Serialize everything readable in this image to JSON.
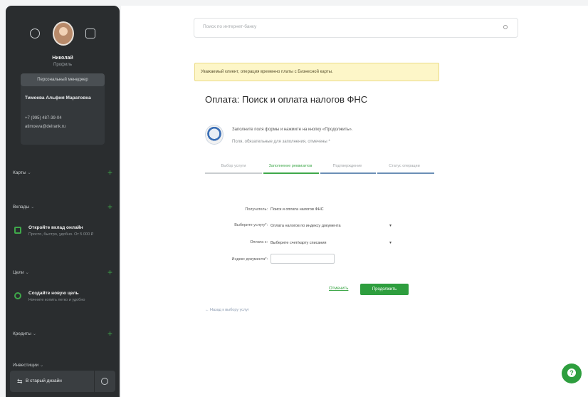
{
  "sidebar": {
    "user_name": "Николай",
    "user_role": "Профиль",
    "manager_button": "Персональный менеджер",
    "manager_name": "Тимоева Альфия Маратовна",
    "manager_phone": "+7 (995) 487-39-04",
    "manager_email": "atimoeva@delrank.ru",
    "sections": [
      {
        "label": "Карты"
      },
      {
        "label": "Вклады"
      },
      {
        "label": "Цели"
      },
      {
        "label": "Кредиты"
      },
      {
        "label": "Инвестиции"
      }
    ],
    "promo_deposit_title": "Откройте вклад онлайн",
    "promo_deposit_sub": "Просто, быстро, удобно. От 5 000 ₽",
    "promo_goal_title": "Создайте новую цель",
    "promo_goal_sub": "Начните копить легко и удобно",
    "old_design_label": "В старый дизайн"
  },
  "search": {
    "placeholder": "Поиск по интернет-банку"
  },
  "notice": "Уважаемый клиент, операция временно платы с Бизнесной карты.",
  "page_title": "Оплата: Поиск и оплата налогов ФНС",
  "fns": {
    "line1": "Заполните поля формы и нажмите на кнопку «Продолжить».",
    "line2": "Поля, обязательные для заполнения, отмечены *"
  },
  "steps": [
    {
      "label": "Выбор услуги"
    },
    {
      "label": "Заполнение реквизитов"
    },
    {
      "label": "Подтверждение"
    },
    {
      "label": "Статус операции"
    }
  ],
  "form": {
    "payee_label": "Получатель:",
    "payee_value": "Поиск и оплата налогов ФНС",
    "service_label": "Выберите услугу*:",
    "service_value": "Оплата налогов по индексу документа",
    "account_label": "Оплата с:",
    "account_value": "Выберите счет/карту списания",
    "index_label": "Индекс документа*:",
    "index_value": ""
  },
  "buttons": {
    "cancel": "Отменить",
    "continue": "Продолжить",
    "back": "← Назад к выбору услуг"
  },
  "colors": {
    "accent": "#2e9e3e",
    "sidebar_bg": "#2a2d2f",
    "notice_bg": "#fdf6c8"
  }
}
